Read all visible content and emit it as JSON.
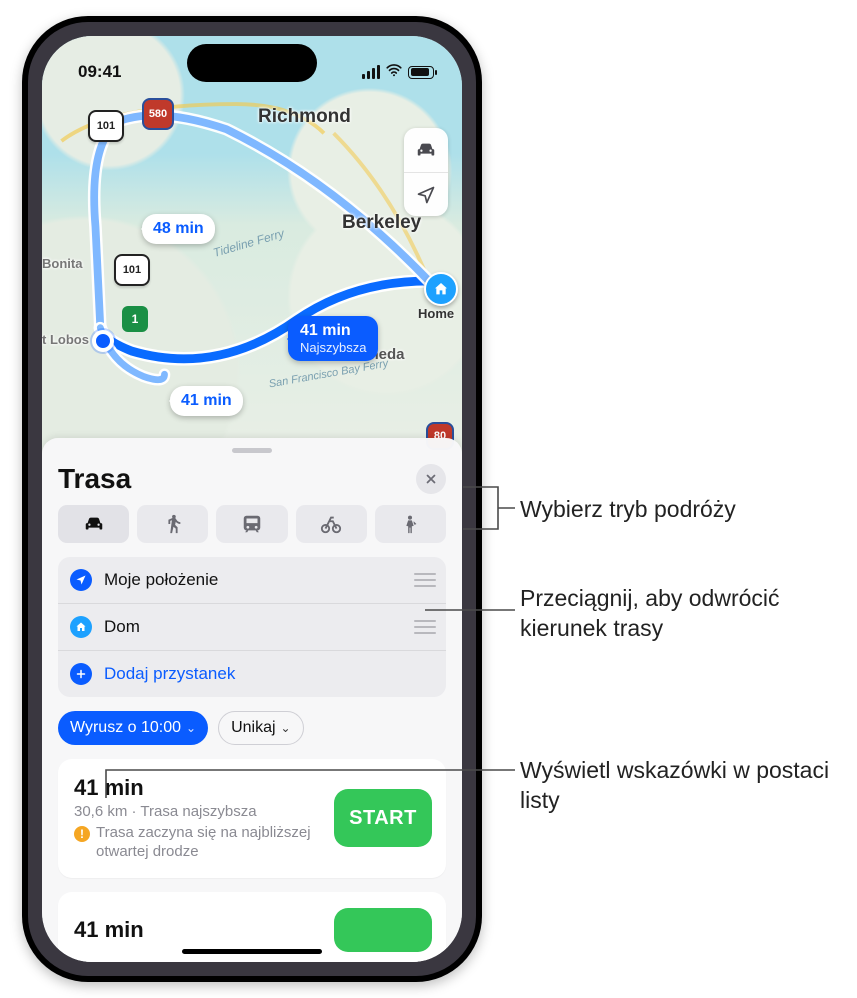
{
  "status": {
    "time": "09:41"
  },
  "map": {
    "cities": {
      "richmond": "Richmond",
      "berkeley": "Berkeley",
      "alameda": "Alameda",
      "bonita": "Bonita",
      "lobos": "t Lobos"
    },
    "ferry1": "Tideline Ferry",
    "ferry2": "San Francisco Bay Ferry",
    "shields": {
      "us101a": "101",
      "us101b": "101",
      "i580": "580",
      "i80": "80",
      "ca1": "1"
    },
    "home_label": "Home",
    "bubbles": {
      "alt1": "48 min",
      "alt2": "41 min",
      "selected_time": "41 min",
      "selected_sub": "Najszybsza"
    }
  },
  "sheet": {
    "title": "Trasa",
    "stops": {
      "from": "Moje położenie",
      "to": "Dom",
      "add": "Dodaj przystanek"
    },
    "depart_chip": "Wyrusz o 10:00",
    "avoid_chip": "Unikaj",
    "routes": [
      {
        "time": "41 min",
        "sub": "30,6 km · Trasa najszybsza",
        "warning": "Trasa zaczyna się na najbliższej otwartej drodze",
        "go": "START"
      },
      {
        "time": "41 min"
      }
    ]
  },
  "callouts": {
    "modes": "Wybierz tryb podróży",
    "drag": "Przeciągnij, aby odwrócić kierunek trasy",
    "list": "Wyświetl wskazówki w postaci listy"
  }
}
